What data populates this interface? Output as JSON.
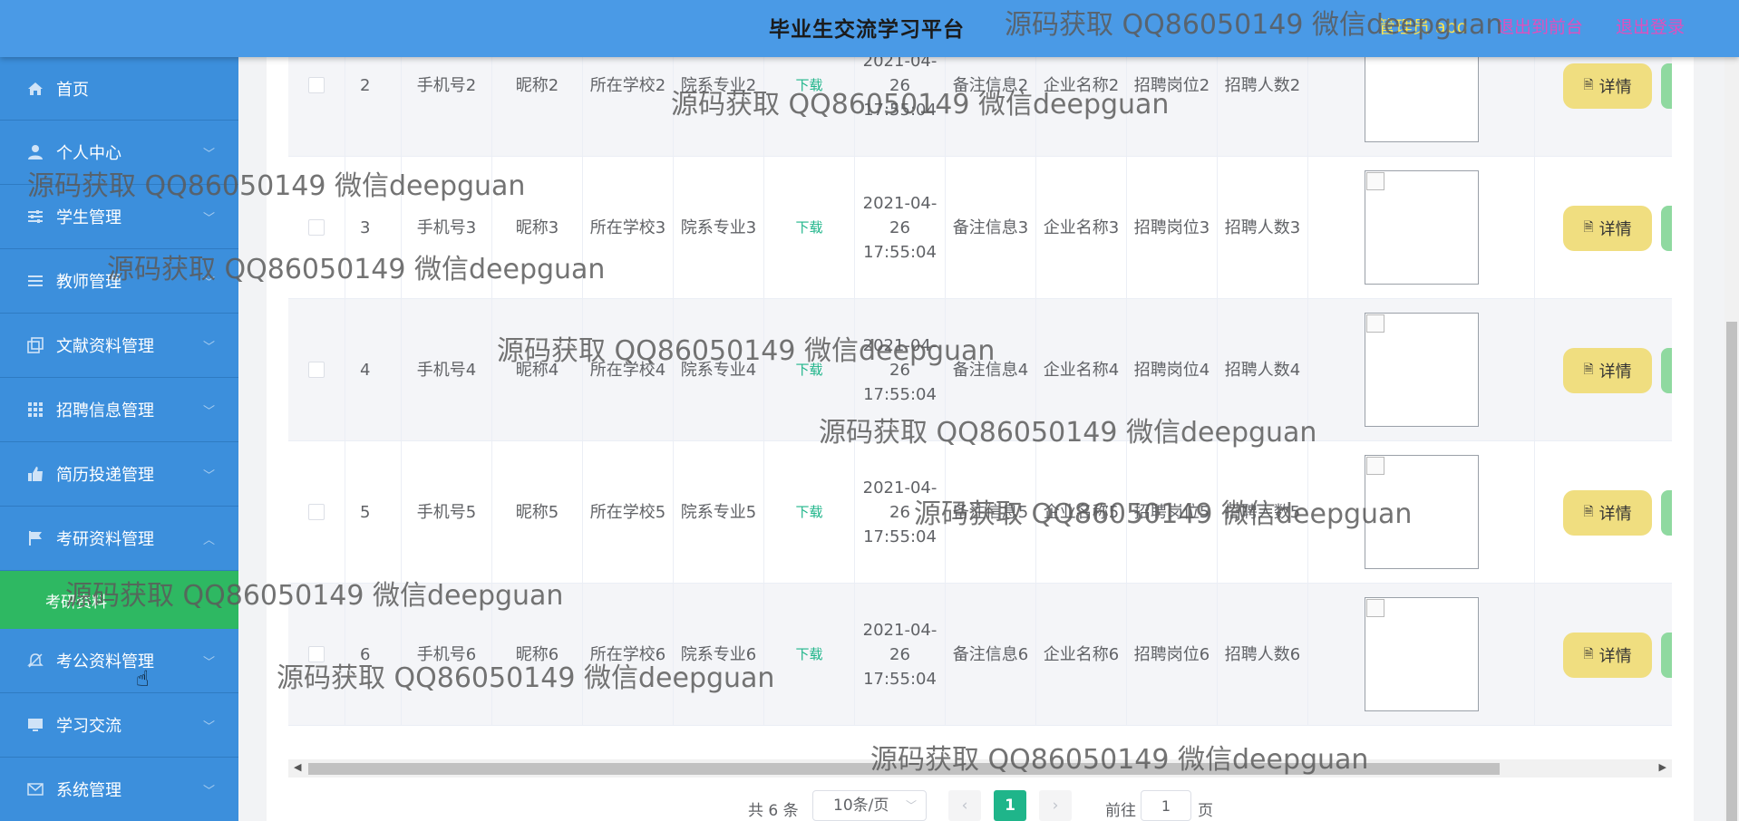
{
  "header": {
    "title": "毕业生交流学习平台",
    "user": "管理员 abo",
    "front_link": "退出到前台",
    "logout_link": "退出登录"
  },
  "sidebar": {
    "items": [
      {
        "label": "首页",
        "icon": "home-icon"
      },
      {
        "label": "个人中心",
        "icon": "user-icon"
      },
      {
        "label": "学生管理",
        "icon": "sliders-icon"
      },
      {
        "label": "教师管理",
        "icon": "list-icon"
      },
      {
        "label": "文献资料管理",
        "icon": "copy-icon"
      },
      {
        "label": "招聘信息管理",
        "icon": "grid-icon"
      },
      {
        "label": "简历投递管理",
        "icon": "thumbs-up-icon"
      },
      {
        "label": "考研资料管理",
        "icon": "flag-icon"
      },
      {
        "label": "考公资料管理",
        "icon": "bell-off-icon"
      },
      {
        "label": "学习交流",
        "icon": "monitor-icon"
      },
      {
        "label": "系统管理",
        "icon": "mail-icon"
      }
    ],
    "active_sub": "考研资料"
  },
  "table": {
    "download_label": "下载",
    "detail_label": "详情",
    "rows": [
      {
        "id": "2",
        "phone": "手机号2",
        "nickname": "昵称2",
        "school": "所在学校2",
        "major": "院系专业2",
        "time": "2021-04-26 17:55:04",
        "note": "备注信息2",
        "company": "企业名称2",
        "position": "招聘岗位2",
        "count": "招聘人数2"
      },
      {
        "id": "3",
        "phone": "手机号3",
        "nickname": "昵称3",
        "school": "所在学校3",
        "major": "院系专业3",
        "time": "2021-04-26 17:55:04",
        "note": "备注信息3",
        "company": "企业名称3",
        "position": "招聘岗位3",
        "count": "招聘人数3"
      },
      {
        "id": "4",
        "phone": "手机号4",
        "nickname": "昵称4",
        "school": "所在学校4",
        "major": "院系专业4",
        "time": "2021-04-26 17:55:04",
        "note": "备注信息4",
        "company": "企业名称4",
        "position": "招聘岗位4",
        "count": "招聘人数4"
      },
      {
        "id": "5",
        "phone": "手机号5",
        "nickname": "昵称5",
        "school": "所在学校5",
        "major": "院系专业5",
        "time": "2021-04-26 17:55:04",
        "note": "备注信息5",
        "company": "企业名称5",
        "position": "招聘岗位5",
        "count": "招聘人数5"
      },
      {
        "id": "6",
        "phone": "手机号6",
        "nickname": "昵称6",
        "school": "所在学校6",
        "major": "院系专业6",
        "time": "2021-04-26 17:55:04",
        "note": "备注信息6",
        "company": "企业名称6",
        "position": "招聘岗位6",
        "count": "招聘人数6"
      }
    ]
  },
  "pagination": {
    "total": "共 6 条",
    "page_size": "10条/页",
    "current": "1",
    "goto_label": "前往",
    "goto_value": "1",
    "page_unit": "页"
  },
  "watermark": "源码获取 QQ86050149 微信deepguan",
  "colors": {
    "header_bg": "#4a9ae6",
    "sidebar_bg": "#3c8fdc",
    "active_green": "#2eb862",
    "detail_button": "#f0de80",
    "accent": "#1fb58a"
  }
}
